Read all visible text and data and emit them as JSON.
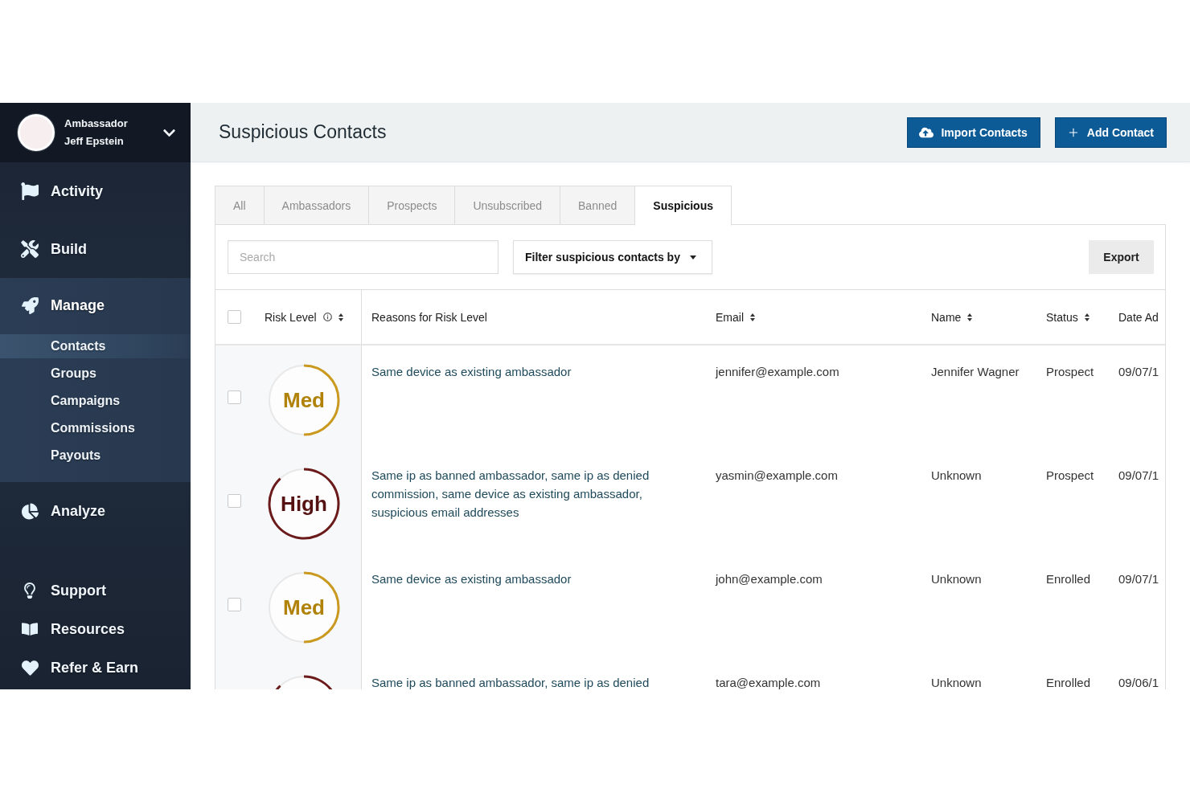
{
  "sidebar": {
    "profile": {
      "role": "Ambassador",
      "name": "Jeff Epstein"
    },
    "items": [
      {
        "label": "Activity",
        "selected": false
      },
      {
        "label": "Build",
        "selected": false
      },
      {
        "label": "Manage",
        "selected": true,
        "children": [
          {
            "label": "Contacts",
            "selected": true
          },
          {
            "label": "Groups",
            "selected": false
          },
          {
            "label": "Campaigns",
            "selected": false
          },
          {
            "label": "Commissions",
            "selected": false
          },
          {
            "label": "Payouts",
            "selected": false
          }
        ]
      },
      {
        "label": "Analyze",
        "selected": false
      }
    ],
    "footer_items": [
      {
        "label": "Support",
        "selected": false
      },
      {
        "label": "Resources",
        "selected": false
      },
      {
        "label": "Refer & Earn",
        "selected": false
      }
    ]
  },
  "header": {
    "title": "Suspicious Contacts",
    "buttons": [
      {
        "label": "Import Contacts"
      },
      {
        "label": "Add Contact"
      }
    ]
  },
  "tabs": [
    {
      "label": "All",
      "selected": false
    },
    {
      "label": "Ambassadors",
      "selected": false
    },
    {
      "label": "Prospects",
      "selected": false
    },
    {
      "label": "Unsubscribed",
      "selected": false
    },
    {
      "label": "Banned",
      "selected": false
    },
    {
      "label": "Suspicious",
      "selected": true
    }
  ],
  "toolbar": {
    "search": {
      "placeholder": "Search"
    },
    "filter": {
      "label": "Filter suspicious contacts by"
    },
    "export": {
      "label": "Export"
    }
  },
  "table": {
    "select_all": {
      "checked": false
    },
    "columns": [
      {
        "label": "Risk Level",
        "info": true,
        "sortable": true
      },
      {
        "label": "Reasons for Risk Level",
        "info": false,
        "sortable": false
      },
      {
        "label": "Email",
        "info": false,
        "sortable": true
      },
      {
        "label": "Name",
        "info": false,
        "sortable": true
      },
      {
        "label": "Status",
        "info": false,
        "sortable": true
      },
      {
        "label": "Date Ad",
        "info": false,
        "sortable": false
      }
    ],
    "rows": [
      {
        "checked": false,
        "risk": {
          "kind": "med",
          "label": "Med"
        },
        "reasons": "Same device as existing ambassador",
        "email": "jennifer@example.com",
        "name": "Jennifer Wagner",
        "status": "Prospect",
        "date": "09/07/1"
      },
      {
        "checked": false,
        "risk": {
          "kind": "high",
          "label": "High"
        },
        "reasons": "Same ip as banned ambassador, same ip as denied commission, same device as existing ambassador, suspicious email addresses",
        "email": "yasmin@example.com",
        "name": "Unknown",
        "status": "Prospect",
        "date": "09/07/1"
      },
      {
        "checked": false,
        "risk": {
          "kind": "med",
          "label": "Med"
        },
        "reasons": "Same device as existing ambassador",
        "email": "john@example.com",
        "name": "Unknown",
        "status": "Enrolled",
        "date": "09/07/1"
      },
      {
        "risk": {
          "kind": "high"
        },
        "reasons": "Same ip as banned ambassador, same ip as denied",
        "email": "tara@example.com",
        "name": "Unknown",
        "status": "Enrolled",
        "date": "09/06/1"
      }
    ]
  }
}
